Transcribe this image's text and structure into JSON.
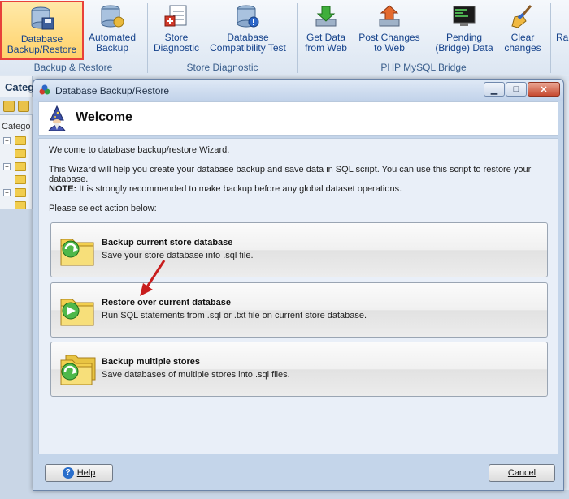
{
  "ribbon": {
    "buttons": [
      {
        "label1": "Database",
        "label2": "Backup/Restore"
      },
      {
        "label1": "Automated",
        "label2": "Backup"
      },
      {
        "label1": "Store",
        "label2": "Diagnostic"
      },
      {
        "label1": "Database",
        "label2": "Compatibility Test"
      },
      {
        "label1": "Get Data",
        "label2": "from Web"
      },
      {
        "label1": "Post Changes",
        "label2": "to Web"
      },
      {
        "label1": "Pending",
        "label2": "(Bridge) Data"
      },
      {
        "label1": "Clear",
        "label2": "changes"
      },
      {
        "label1": "Ra",
        "label2": ""
      }
    ],
    "groups": [
      "Backup & Restore",
      "Store Diagnostic",
      "PHP MySQL Bridge"
    ]
  },
  "behind": {
    "caption": "Categ",
    "tree_label": "Catego"
  },
  "dialog": {
    "title": "Database Backup/Restore",
    "header_title": "Welcome",
    "intro": "Welcome to database backup/restore Wizard.",
    "description": "This Wizard will help you create your database backup and save data in SQL script. You can use this script to restore your database.",
    "note_label": "NOTE:",
    "note_text": " It is strongly recommended to make backup before any global dataset operations.",
    "prompt": "Please select action below:",
    "actions": [
      {
        "title": "Backup current store database",
        "desc": "Save your store database into .sql file."
      },
      {
        "title": "Restore over current database",
        "desc": "Run SQL statements from .sql or .txt file on current store database."
      },
      {
        "title": "Backup multiple stores",
        "desc": "Save databases of multiple stores into .sql files."
      }
    ],
    "help_label": "Help",
    "cancel_label": "Cancel"
  }
}
